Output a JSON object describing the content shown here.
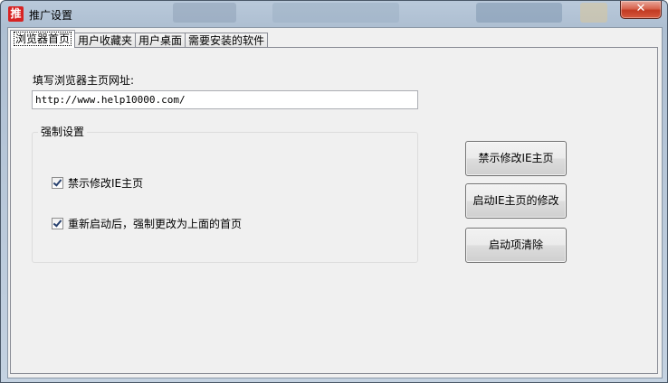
{
  "window": {
    "title": "推广设置",
    "icon_char": "推",
    "close_glyph": "✕"
  },
  "tabs": [
    {
      "label": "浏览器首页",
      "active": true
    },
    {
      "label": "用户收藏夹",
      "active": false
    },
    {
      "label": "用户桌面",
      "active": false
    },
    {
      "label": "需要安装的软件",
      "active": false
    }
  ],
  "homepage": {
    "label": "填写浏览器主页网址:",
    "url_value": "http://www.help10000.com/"
  },
  "force_settings": {
    "title": "强制设置",
    "options": [
      {
        "label": "禁示修改IE主页",
        "checked": true
      },
      {
        "label": "重新启动后，强制更改为上面的首页",
        "checked": true
      }
    ]
  },
  "buttons": {
    "disable_ie_edit": "禁示修改IE主页",
    "enable_ie_edit": "启动IE主页的修改",
    "clear_startup": "启动项清除"
  }
}
